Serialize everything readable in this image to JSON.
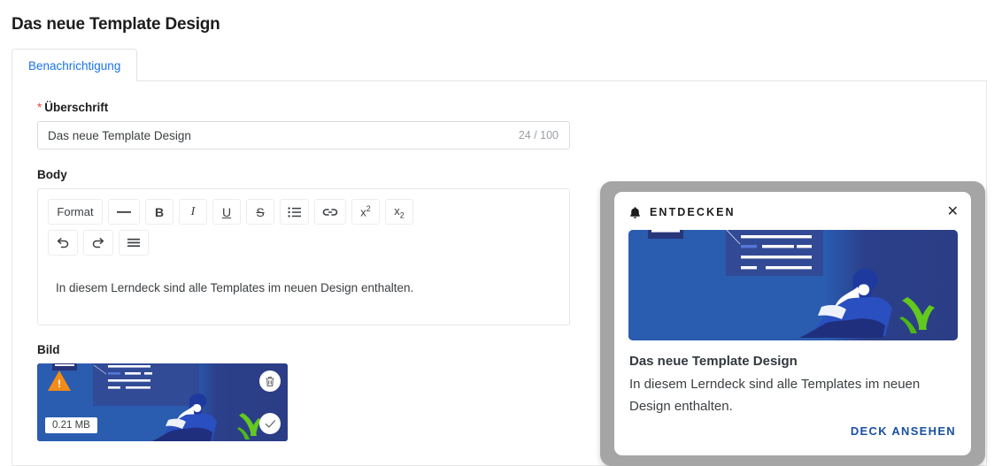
{
  "page": {
    "title": "Das neue Template Design"
  },
  "tabs": [
    {
      "label": "Benachrichtigung",
      "active": true
    }
  ],
  "form": {
    "headline": {
      "required_marker": "*",
      "label": "Überschrift",
      "value": "Das neue Template Design",
      "placeholder": "Überschrift",
      "counter": "24 / 100"
    },
    "body": {
      "label": "Body",
      "value": "In diesem Lerndeck sind alle Templates im neuen Design enthalten.",
      "toolbar_row1": [
        {
          "name": "format-dropdown",
          "label": "Format"
        },
        {
          "name": "horizontal-rule-icon",
          "label": "—"
        },
        {
          "name": "bold-icon",
          "label": "B"
        },
        {
          "name": "italic-icon",
          "label": "I"
        },
        {
          "name": "underline-icon",
          "label": "U"
        },
        {
          "name": "strikethrough-icon",
          "label": "S"
        },
        {
          "name": "bullet-list-icon",
          "label": "list"
        },
        {
          "name": "link-icon",
          "label": "link"
        },
        {
          "name": "superscript-icon",
          "label": "x2"
        },
        {
          "name": "subscript-icon",
          "label": "x2"
        }
      ],
      "toolbar_row2": [
        {
          "name": "undo-icon",
          "label": "undo"
        },
        {
          "name": "redo-icon",
          "label": "redo"
        },
        {
          "name": "align-icon",
          "label": "align"
        }
      ]
    },
    "image": {
      "label": "Bild",
      "file_size": "0.21 MB",
      "warning_icon": "warning-triangle-icon",
      "delete_icon": "trash-icon",
      "confirm_icon": "check-icon"
    }
  },
  "preview": {
    "header_label": "ENTDECKEN",
    "bell_icon": "bell-icon",
    "close_icon": "close-icon",
    "title": "Das neue Template Design",
    "description": "In diesem Lerndeck sind alle Templates im neuen Design enthalten.",
    "cta": "DECK ANSEHEN"
  },
  "colors": {
    "accent_blue": "#1a73e8",
    "link_blue": "#1a4fa0",
    "required_red": "#e8453c",
    "warning_orange": "#f18c19",
    "illustration_blue": "#2a5cb0",
    "illustration_navy": "#2b3d85",
    "frame_gray": "#a5a5a5"
  }
}
